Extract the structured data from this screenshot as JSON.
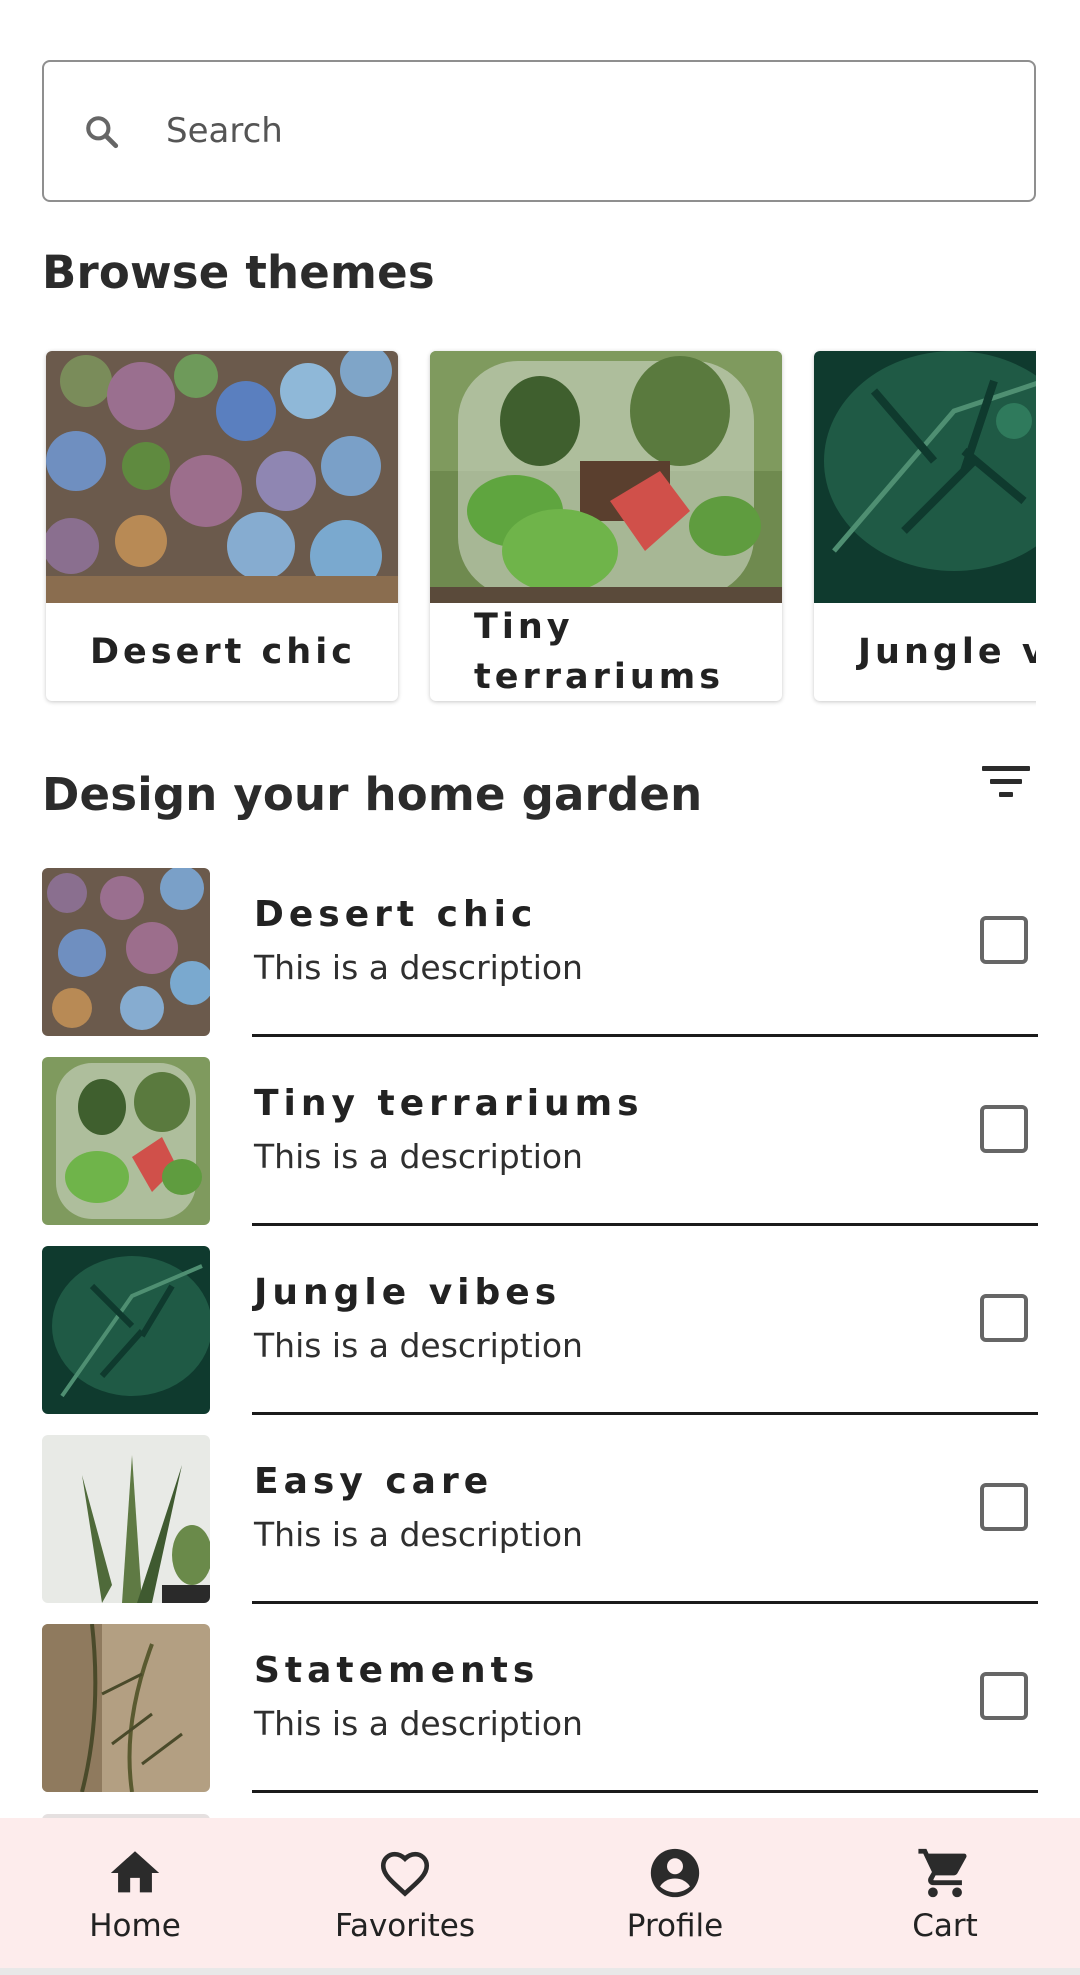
{
  "search": {
    "placeholder": "Search"
  },
  "browse": {
    "title": "Browse themes",
    "cards": [
      {
        "label": "Desert chic",
        "image": "succulents-photo"
      },
      {
        "label": "Tiny terrariums",
        "image": "terrarium-photo"
      },
      {
        "label": "Jungle vibes",
        "image": "monstera-photo"
      }
    ]
  },
  "garden": {
    "title": "Design your home garden",
    "items": [
      {
        "title": "Desert chic",
        "description": "This is a description",
        "checked": false
      },
      {
        "title": "Tiny terrariums",
        "description": "This is a description",
        "checked": false
      },
      {
        "title": "Jungle vibes",
        "description": "This is a description",
        "checked": false
      },
      {
        "title": "Easy care",
        "description": "This is a description",
        "checked": false
      },
      {
        "title": "Statements",
        "description": "This is a description",
        "checked": false
      }
    ]
  },
  "nav": {
    "items": [
      {
        "label": "Home",
        "icon": "home-icon"
      },
      {
        "label": "Favorites",
        "icon": "heart-icon"
      },
      {
        "label": "Profile",
        "icon": "account-circle-icon"
      },
      {
        "label": "Cart",
        "icon": "cart-icon"
      }
    ]
  },
  "colors": {
    "nav_background": "#fdecec",
    "text": "#232323",
    "divider": "#1b1b1b"
  }
}
